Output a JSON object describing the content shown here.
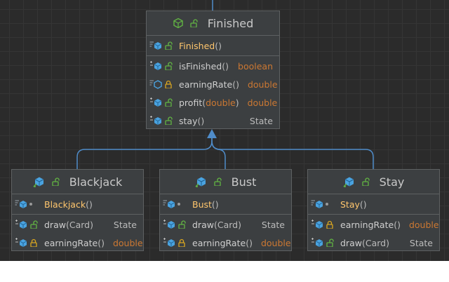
{
  "colors": {
    "canvas": "#2b2b2b",
    "box_bg": "#3c3f41",
    "box_border": "#5e6162",
    "connector": "#4f8cc9",
    "constructor_name": "#ffc66d",
    "primitive_type": "#cc7832",
    "lock_green": "#62b543",
    "lock_yellow": "#d9a620",
    "method_icon": "#4aa3e0"
  },
  "diagram": {
    "classes": [
      {
        "name": "Finished",
        "icon": "abstract-class-icon",
        "sections": [
          [
            {
              "name": "Finished",
              "params": "()",
              "ret": "",
              "ctor": true,
              "kind": "constructor",
              "vis": "public"
            }
          ],
          [
            {
              "name": "isFinished",
              "params": "()",
              "ret": "boolean",
              "prim": true,
              "kind": "override",
              "vis": "public"
            },
            {
              "name": "earningRate",
              "params": "()",
              "ret": "double",
              "prim": true,
              "kind": "abstract",
              "vis": "protected"
            },
            {
              "name": "profit",
              "params": "(double)",
              "ptype": "double",
              "ret": "double",
              "prim": true,
              "kind": "override",
              "vis": "public"
            },
            {
              "name": "stay",
              "params": "()",
              "ret": "State",
              "prim": false,
              "kind": "override",
              "vis": "public"
            }
          ]
        ]
      },
      {
        "name": "Blackjack",
        "icon": "class-icon",
        "sections": [
          [
            {
              "name": "Blackjack",
              "params": "()",
              "ret": "",
              "ctor": true,
              "kind": "constructor",
              "vis": "package"
            }
          ],
          [
            {
              "name": "draw",
              "params": "(Card)",
              "ret": "State",
              "prim": false,
              "kind": "override",
              "vis": "public"
            },
            {
              "name": "earningRate",
              "params": "()",
              "ret": "double",
              "prim": true,
              "kind": "override",
              "vis": "protected"
            }
          ]
        ]
      },
      {
        "name": "Bust",
        "icon": "class-icon",
        "sections": [
          [
            {
              "name": "Bust",
              "params": "()",
              "ret": "",
              "ctor": true,
              "kind": "constructor",
              "vis": "package"
            }
          ],
          [
            {
              "name": "draw",
              "params": "(Card)",
              "ret": "State",
              "prim": false,
              "kind": "override",
              "vis": "public"
            },
            {
              "name": "earningRate",
              "params": "()",
              "ret": "double",
              "prim": true,
              "kind": "override",
              "vis": "protected"
            }
          ]
        ]
      },
      {
        "name": "Stay",
        "icon": "class-icon",
        "sections": [
          [
            {
              "name": "Stay",
              "params": "()",
              "ret": "",
              "ctor": true,
              "kind": "constructor",
              "vis": "package"
            }
          ],
          [
            {
              "name": "earningRate",
              "params": "()",
              "ret": "double",
              "prim": true,
              "kind": "override",
              "vis": "protected"
            },
            {
              "name": "draw",
              "params": "(Card)",
              "ret": "State",
              "prim": false,
              "kind": "override",
              "vis": "public"
            }
          ]
        ]
      }
    ]
  }
}
